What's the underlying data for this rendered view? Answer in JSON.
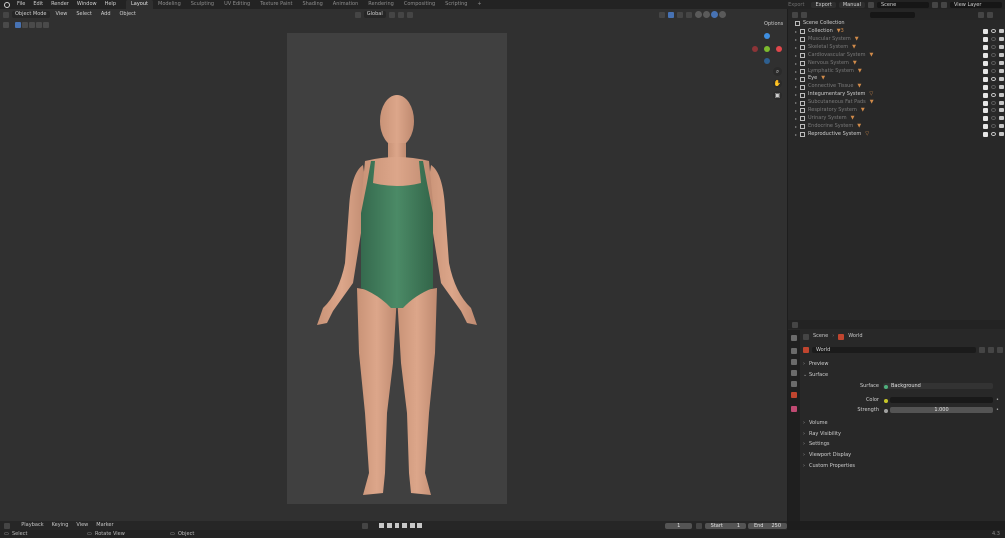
{
  "menubar": {
    "menus": [
      "File",
      "Edit",
      "Render",
      "Window",
      "Help"
    ],
    "workspaces": [
      "Layout",
      "Modeling",
      "Sculpting",
      "UV Editing",
      "Texture Paint",
      "Shading",
      "Animation",
      "Rendering",
      "Compositing",
      "Scripting"
    ],
    "active_workspace": "Layout",
    "add_tab": "+",
    "export_dim": "Export",
    "export": "Export",
    "manual": "Manual",
    "scene": "Scene",
    "view_layer": "View Layer"
  },
  "viewport": {
    "mode": "Object Mode",
    "menus": [
      "View",
      "Select",
      "Add",
      "Object"
    ],
    "transform_orientation": "Global",
    "options": "Options",
    "gizmo_axes": {
      "x_color": "#e0474b",
      "y_color": "#7dba2e",
      "z_color": "#3e8ee0"
    }
  },
  "outliner": {
    "root": "Scene Collection",
    "items": [
      {
        "name": "Collection",
        "badge": "▼3",
        "visible": true
      },
      {
        "name": "Muscular System",
        "badge": "▼",
        "visible": false
      },
      {
        "name": "Skeletal System",
        "badge": "▼",
        "visible": false
      },
      {
        "name": "Cardiovascular System",
        "badge": "▼",
        "visible": false
      },
      {
        "name": "Nervous System",
        "badge": "▼",
        "visible": false
      },
      {
        "name": "Lymphatic System",
        "badge": "▼",
        "visible": false
      },
      {
        "name": "Eye",
        "badge": "▼",
        "visible": true
      },
      {
        "name": "Connective Tissue",
        "badge": "▼",
        "visible": false
      },
      {
        "name": "Integumentary System",
        "badge": "▽",
        "visible": true
      },
      {
        "name": "Subcutaneous Fat Pads",
        "badge": "▼",
        "visible": false
      },
      {
        "name": "Respiratory System",
        "badge": "▼",
        "visible": false
      },
      {
        "name": "Urinary System",
        "badge": "▼",
        "visible": false
      },
      {
        "name": "Endocrine System",
        "badge": "▼",
        "visible": false
      },
      {
        "name": "Reproductive System",
        "badge": "▽",
        "visible": true
      }
    ]
  },
  "properties": {
    "breadcrumb_scene": "Scene",
    "breadcrumb_world": "World",
    "world_name": "World",
    "panels_top": [
      "Preview",
      "Surface"
    ],
    "surface_label": "Surface",
    "surface_value": "Background",
    "color_label": "Color",
    "strength_label": "Strength",
    "strength_value": "1.000",
    "panels_bottom": [
      "Volume",
      "Ray Visibility",
      "Settings",
      "Viewport Display",
      "Custom Properties"
    ]
  },
  "timeline": {
    "menus": [
      "Playback",
      "Keying",
      "View",
      "Marker"
    ],
    "current_frame": "1",
    "start_label": "Start",
    "start_value": "1",
    "end_label": "End",
    "end_value": "250"
  },
  "statusbar": {
    "select": "Select",
    "rotate_view": "Rotate View",
    "object": "Object",
    "version": "4.3"
  }
}
